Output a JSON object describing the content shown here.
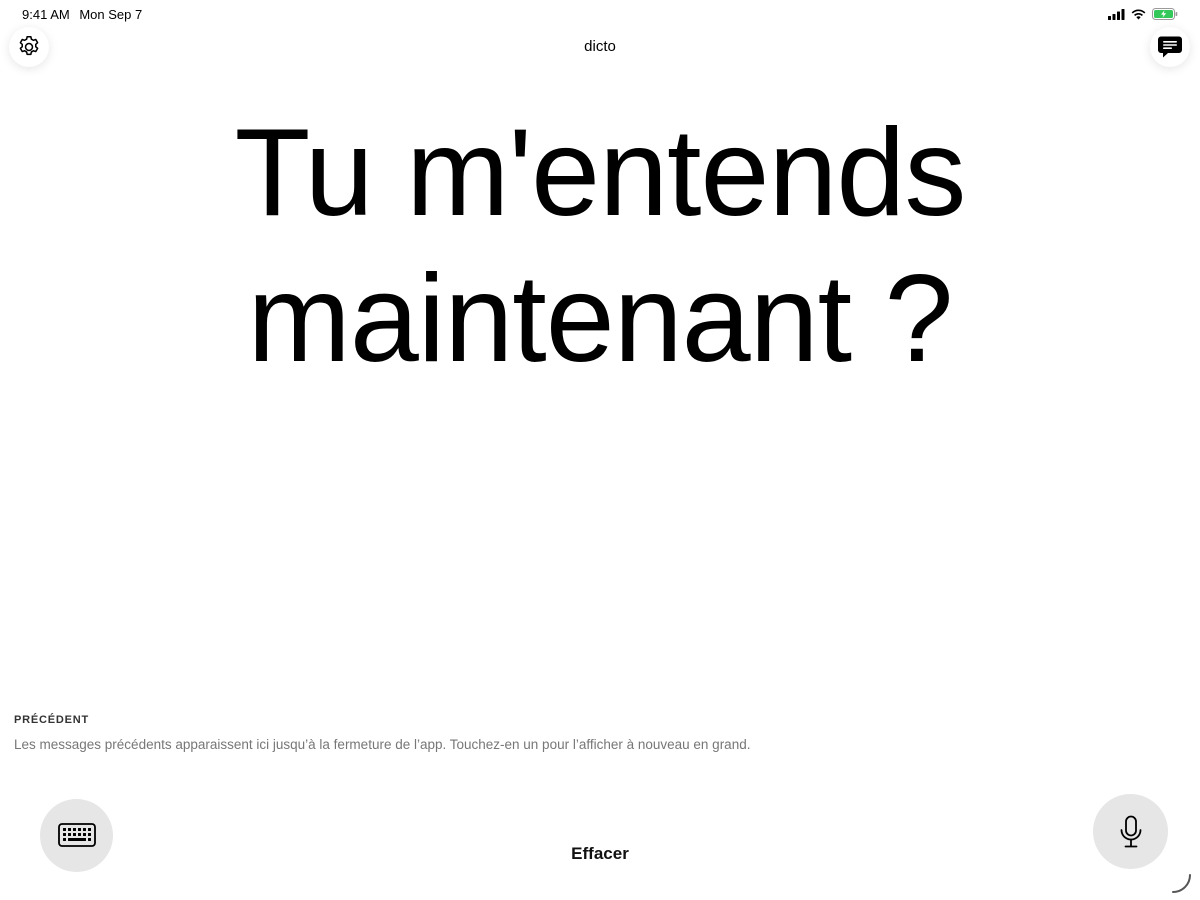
{
  "status_bar": {
    "time": "9:41 AM",
    "date": "Mon Sep 7",
    "icons": [
      "cellular-signal-icon",
      "wifi-icon",
      "battery-charging-icon"
    ],
    "battery_color": "#34c759"
  },
  "header": {
    "title": "dicto",
    "settings_icon": "gear-icon",
    "history_icon": "chat-bubble-icon"
  },
  "transcript": {
    "line1": "Tu m'entends",
    "line2": "maintenant ?"
  },
  "previous": {
    "heading": "PRÉCÉDENT",
    "description": "Les messages précédents apparaissent ici jusqu’à la fermeture de l’app. Touchez-en un pour l’afficher à nouveau en grand."
  },
  "controls": {
    "keyboard_icon": "keyboard-icon",
    "clear_label": "Effacer",
    "mic_icon": "microphone-icon"
  }
}
